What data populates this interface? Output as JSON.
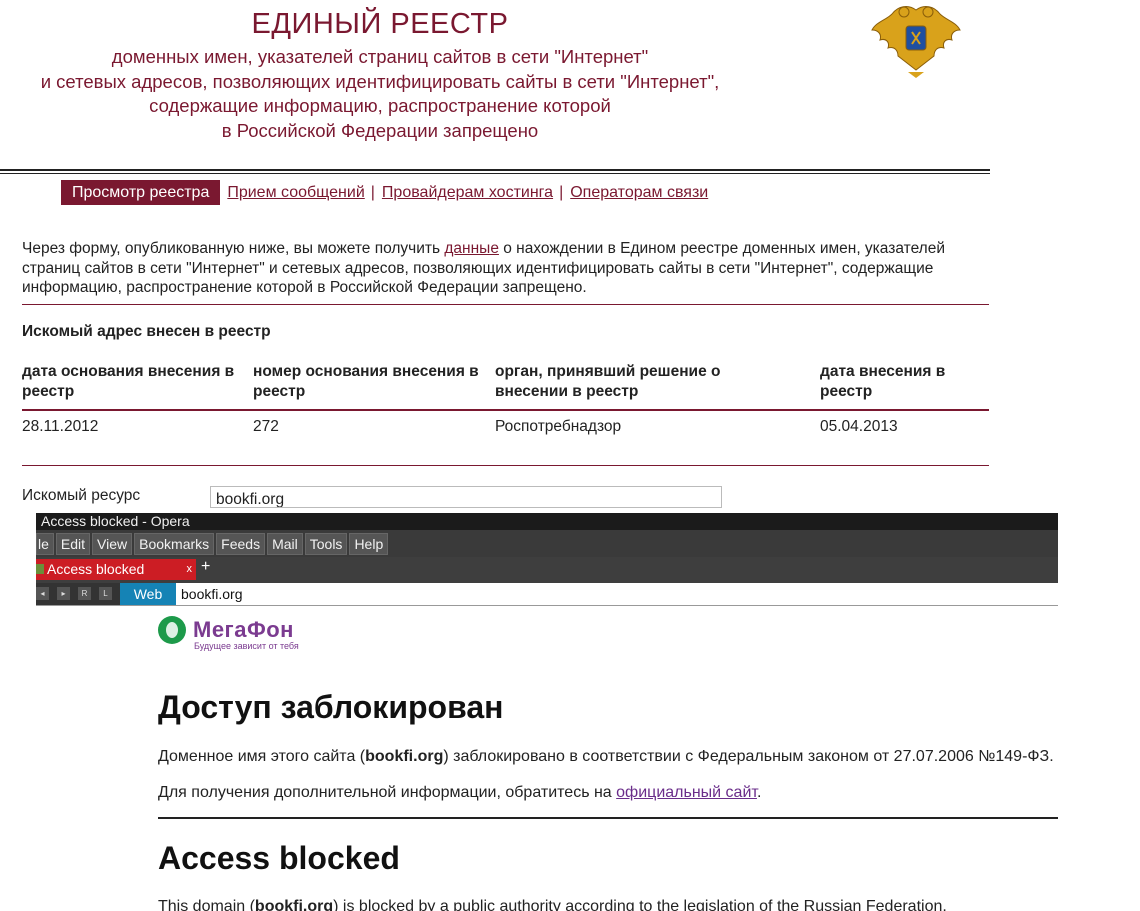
{
  "registry": {
    "title": "ЕДИНЫЙ РЕЕСТР",
    "subtitle_lines": [
      "доменных имен, указателей страниц сайтов в сети \"Интернет\"",
      "и сетевых адресов, позволяющих идентифицировать сайты в сети \"Интернет\",",
      "содержащие информацию, распространение которой",
      "в Российской Федерации запрещено"
    ],
    "nav": {
      "active": "Просмотр реестра",
      "links": [
        "Прием сообщений",
        "Провайдерам хостинга",
        "Операторам связи"
      ],
      "separator": "|"
    },
    "intro_before": "Через форму, опубликованную ниже, вы можете получить ",
    "intro_link": "данные",
    "intro_after": " о нахождении в Едином реестре доменных имен, указателей страниц сайтов в сети \"Интернет\" и сетевых адресов, позволяющих идентифицировать сайты в сети \"Интернет\", содержащие информацию, распространение которой в Российской Федерации запрещено.",
    "found_heading": "Искомый адрес внесен в реестр",
    "table": {
      "headers": [
        "дата основания внесения в реестр",
        "номер основания внесения в реестр",
        "орган, принявший решение о внесении в реестр",
        "дата внесения в реестр"
      ],
      "row": [
        "28.11.2012",
        "272",
        "Роспотребнадзор",
        "05.04.2013"
      ]
    },
    "resource_label": "Искомый ресурс",
    "resource_value": "bookfi.org"
  },
  "browser": {
    "window_title": "Access blocked - Opera",
    "menu": [
      "le",
      "Edit",
      "View",
      "Bookmarks",
      "Feeds",
      "Mail",
      "Tools",
      "Help"
    ],
    "tab_label": "Access blocked",
    "tab_close": "x",
    "new_tab": "+",
    "search_engine": "Web",
    "address": "bookfi.org",
    "colors": {
      "tab_active": "#cc1d24",
      "web_button": "#1583b5"
    }
  },
  "blocked_page": {
    "logo_name": "МегаФон",
    "logo_slogan": "Будущее зависит от тебя",
    "heading_ru": "Доступ заблокирован",
    "p1_before": "Доменное имя этого сайта (",
    "p1_domain": "bookfi.org",
    "p1_after": ") заблокировано в соответствии с Федеральным законом от 27.07.2006 №149-ФЗ.",
    "p2_before": "Для получения дополнительной информации, обратитесь на ",
    "p2_link": "официальный сайт",
    "p2_after": ".",
    "heading_en": "Access blocked",
    "p3_before": "This domain (",
    "p3_domain": "bookfi.org",
    "p3_after": ") is blocked by a public authority according to the legislation of the Russian Federation."
  }
}
